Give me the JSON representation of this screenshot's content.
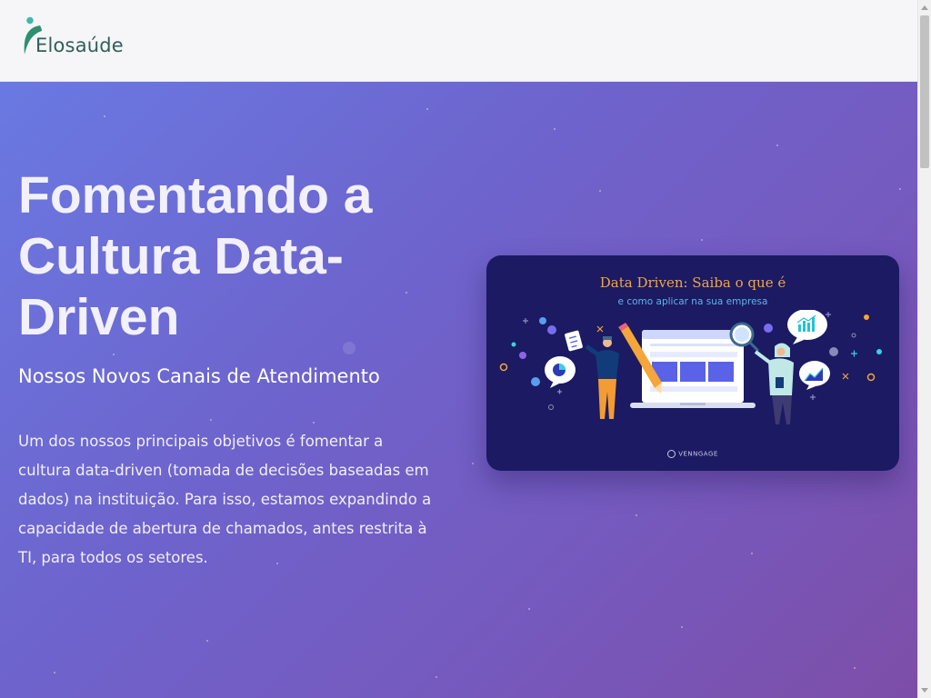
{
  "header": {
    "logo_text": "Elosaúde"
  },
  "hero": {
    "title": "Fomentando a Cultura Data-Driven",
    "subtitle": "Nossos Novos Canais de Atendimento",
    "body": "Um dos nossos principais objetivos é fomentar a cultura data-driven (tomada de decisões baseadas em dados) na instituição. Para isso, estamos expandindo a capacidade de abertura de chamados, antes restrita à TI, para todos os setores."
  },
  "illustration": {
    "title": "Data Driven: Saiba o que é",
    "subtitle": "e como aplicar na sua empresa",
    "brand": "VENNGAGE"
  },
  "colors": {
    "hero_gradient_start": "#6a79e2",
    "hero_gradient_end": "#7d4ea8",
    "card_background": "#1b1a63",
    "card_title": "#f4a63a",
    "card_subtitle": "#62b4e8",
    "logo_green": "#2f5f5a",
    "logo_teal": "#3fb8b0"
  }
}
